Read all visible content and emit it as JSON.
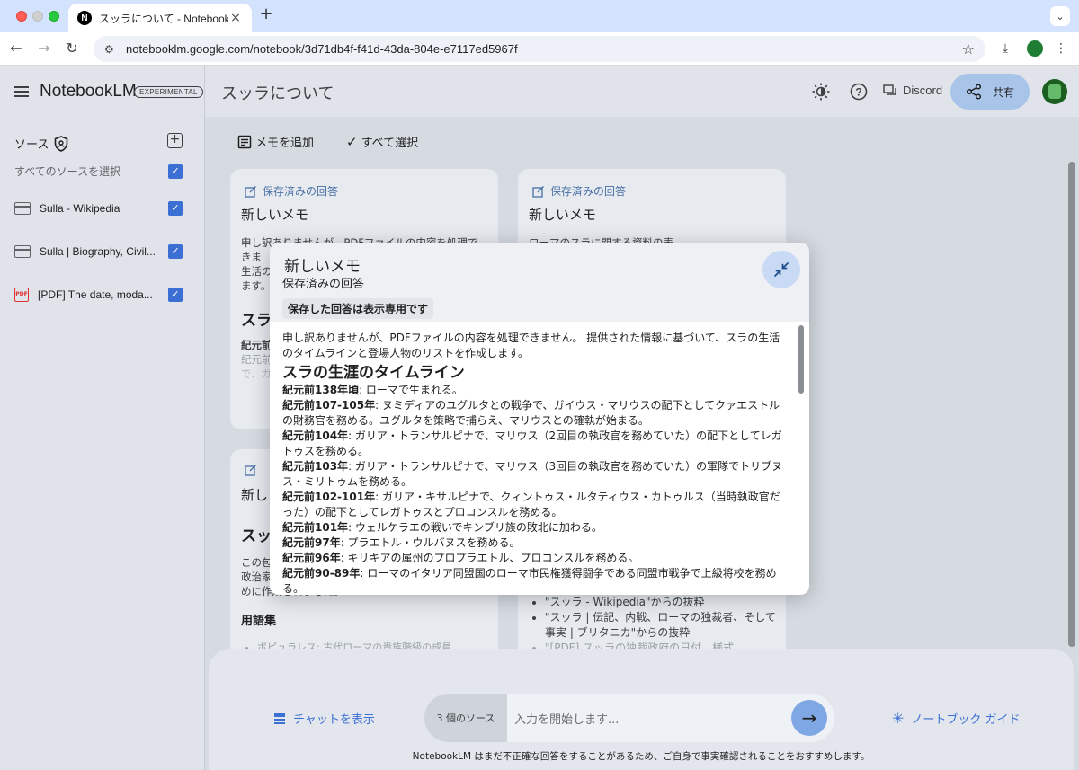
{
  "browser": {
    "tab_title": "スッラについて - NotebookLM",
    "tab_favicon": "N",
    "url": "notebooklm.google.com/notebook/3d71db4f-f41d-43da-804e-e7117ed5967f"
  },
  "header": {
    "logo": "NotebookLM",
    "badge": "EXPERIMENTAL",
    "notebook_title": "スッラについて",
    "discord": "Discord",
    "share": "共有"
  },
  "sidebar": {
    "title": "ソース",
    "select_all": "すべてのソースを選択",
    "sources": [
      {
        "label": "Sulla - Wikipedia",
        "type": "web",
        "checked": true
      },
      {
        "label": "Sulla | Biography, Civil...",
        "type": "web",
        "checked": true
      },
      {
        "label": "[PDF] The date, moda...",
        "type": "pdf",
        "checked": true
      }
    ]
  },
  "main": {
    "add_note": "メモを追加",
    "select_all": "すべて選択",
    "cards": [
      {
        "kind": "保存済みの回答",
        "title": "新しいメモ",
        "snippet": "申し訳ありませんが、PDFファイルの内容を処理できま",
        "line2": "生活の",
        "line3": "ます。",
        "heading": "スラ",
        "p1": "紀元前",
        "p2": "紀元前",
        "p3": "で、ガ"
      },
      {
        "kind": "保存済みの回答",
        "title": "新しいメモ",
        "snippet": "ローマのスラに関する資料の表"
      },
      {
        "kind": "保存済みの回答",
        "title": "新し",
        "heading": "スッ",
        "b1": "この包",
        "b2": "政治家",
        "b3": "めに作成されました。",
        "sub": "用語集",
        "li": "ポピュラレス: 古代ローマの貴族階級の成員"
      },
      {
        "items": [
          "\"スッラ - Wikipedia\"からの抜粋",
          "\"スッラ | 伝記、内戦、ローマの独裁者、そして事実 | ブリタニカ\"からの抜粋",
          "\"[PDF] スッラの独裁政府の日付、様式"
        ]
      }
    ]
  },
  "chat": {
    "show_chat": "チャットを表示",
    "source_count": "3 個のソース",
    "placeholder": "入力を開始します...",
    "guide": "ノートブック ガイド",
    "disclaimer": "NotebookLM はまだ不正確な回答をすることがあるため、ご自身で事実確認されることをおすすめします。"
  },
  "modal": {
    "title": "新しいメモ",
    "subtitle": "保存済みの回答",
    "readonly": "保存した回答は表示専用です",
    "intro": "申し訳ありませんが、PDFファイルの内容を処理できません。 提供された情報に基づいて、スラの生活のタイムラインと登場人物のリストを作成します。",
    "heading": "スラの生涯のタイムライン",
    "events": [
      {
        "date": "紀元前138年頃",
        "text": ": ローマで生まれる。"
      },
      {
        "date": "紀元前107-105年",
        "text": ": ヌミディアのユグルタとの戦争で、ガイウス・マリウスの配下としてクァエストルの財務官を務める。ユグルタを策略で捕らえ、マリウスとの確執が始まる。"
      },
      {
        "date": "紀元前104年",
        "text": ": ガリア・トランサルピナで、マリウス（2回目の執政官を務めていた）の配下としてレガトゥスを務める。"
      },
      {
        "date": "紀元前103年",
        "text": ": ガリア・トランサルピナで、マリウス（3回目の執政官を務めていた）の軍隊でトリブヌス・ミリトゥムを務める。"
      },
      {
        "date": "紀元前102-101年",
        "text": ": ガリア・キサルピナで、クィントゥス・ルタティウス・カトゥルス（当時執政官だった）の配下としてレガトゥスとプロコンスルを務める。"
      },
      {
        "date": "紀元前101年",
        "text": ": ウェルケラエの戦いでキンブリ族の敗北に加わる。"
      },
      {
        "date": "紀元前97年",
        "text": ": プラエトル・ウルバヌスを務める。"
      },
      {
        "date": "紀元前96年",
        "text": ": キリキアの属州のプロプラエトル、プロコンスルを務める。"
      },
      {
        "date": "紀元前90-89年",
        "text": ": ローマのイタリア同盟国のローマ市民権獲得闘争である同盟市戦争で上級将校を務める。"
      }
    ]
  },
  "colors": {
    "accent": "#3b6fd4",
    "share_bg": "#a9c4e9",
    "send_bg": "#7fa7e3"
  }
}
